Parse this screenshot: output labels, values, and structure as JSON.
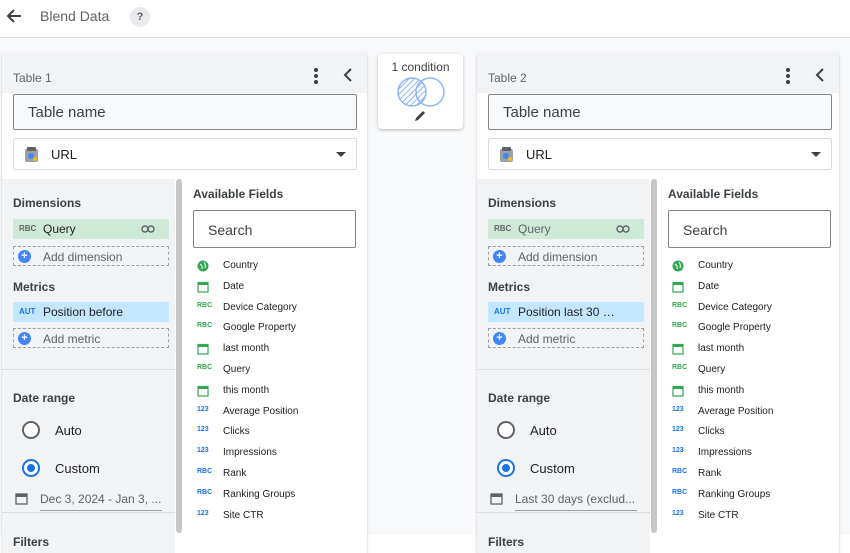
{
  "header": {
    "title": "Blend Data",
    "help": "?"
  },
  "join": {
    "label": "1 condition"
  },
  "colors": {
    "accent": "#1a73e8",
    "dimension": "#ceead6",
    "metric": "#c2e7ff"
  },
  "tables": [
    {
      "label": "Table 1",
      "name_placeholder": "Table name",
      "source": "URL",
      "dimensions_title": "Dimensions",
      "dimension": "Query",
      "add_dimension": "Add dimension",
      "metrics_title": "Metrics",
      "metric": "Position before",
      "add_metric": "Add metric",
      "date_range_title": "Date range",
      "auto_label": "Auto",
      "custom_label": "Custom",
      "date_value": "Dec 3, 2024 - Jan 3, ...",
      "filters_title": "Filters",
      "available_title": "Available Fields",
      "search_placeholder": "Search"
    },
    {
      "label": "Table 2",
      "name_placeholder": "Table name",
      "source": "URL",
      "dimensions_title": "Dimensions",
      "dimension": "Query",
      "add_dimension": "Add dimension",
      "metrics_title": "Metrics",
      "metric": "Position last 30 d...",
      "add_metric": "Add metric",
      "date_range_title": "Date range",
      "auto_label": "Auto",
      "custom_label": "Custom",
      "date_value": "Last 30 days (exclud...",
      "filters_title": "Filters",
      "available_title": "Available Fields",
      "search_placeholder": "Search"
    }
  ],
  "fields": [
    {
      "name": "Country",
      "icon": "globe-icon",
      "type": "geo"
    },
    {
      "name": "Date",
      "icon": "calendar-icon",
      "type": "date"
    },
    {
      "name": "Device Category",
      "icon": "abc-icon",
      "type": "text"
    },
    {
      "name": "Google Property",
      "icon": "abc-icon",
      "type": "text"
    },
    {
      "name": "last month",
      "icon": "calendar-icon",
      "type": "date"
    },
    {
      "name": "Query",
      "icon": "abc-icon",
      "type": "text"
    },
    {
      "name": "this month",
      "icon": "calendar-icon",
      "type": "date"
    },
    {
      "name": "Average Position",
      "icon": "123-icon",
      "type": "number"
    },
    {
      "name": "Clicks",
      "icon": "123-icon",
      "type": "number"
    },
    {
      "name": "Impressions",
      "icon": "123-icon",
      "type": "number"
    },
    {
      "name": "Rank",
      "icon": "rabc-icon",
      "type": "calc-text"
    },
    {
      "name": "Ranking Groups",
      "icon": "rabc-icon",
      "type": "calc-text"
    },
    {
      "name": "Site CTR",
      "icon": "123-icon",
      "type": "number"
    }
  ]
}
